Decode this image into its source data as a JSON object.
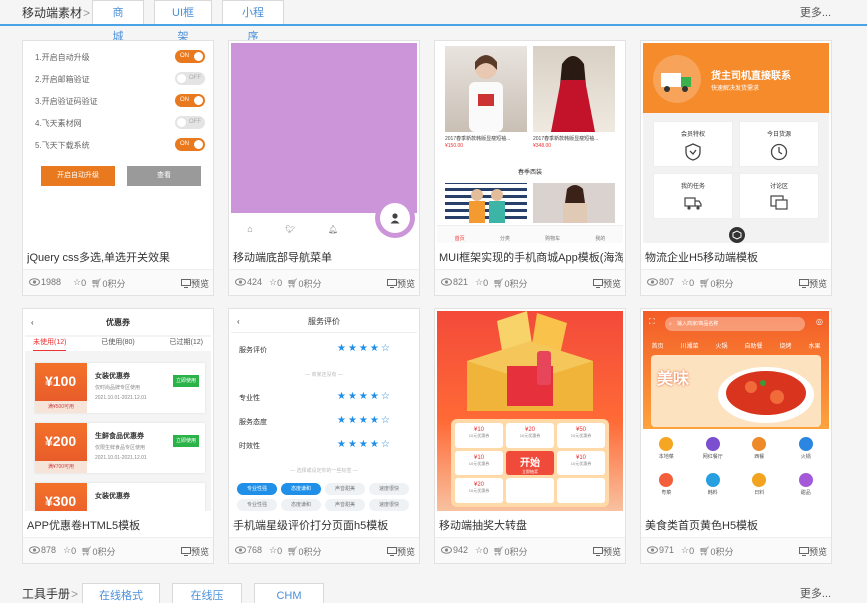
{
  "section_top": {
    "title": "移动端素材",
    "arrow": ">",
    "tabs": [
      "商城",
      "UI框架",
      "小程序"
    ],
    "more": "更多..."
  },
  "section_bottom": {
    "title": "工具手册",
    "arrow": ">",
    "tabs": [
      "在线格式化",
      "在线压缩",
      "CHM文档"
    ],
    "more": "更多..."
  },
  "preview_label": "预览",
  "cards": [
    {
      "title": "jQuery css多选,单选开关效果",
      "views": "1988",
      "stars": "0",
      "points": "0积分"
    },
    {
      "title": "移动端底部导航菜单",
      "views": "424",
      "stars": "0",
      "points": "0积分"
    },
    {
      "title": "MUI框架实现的手机商城App模板(海淘)",
      "views": "821",
      "stars": "0",
      "points": "0积分"
    },
    {
      "title": "物流企业H5移动端模板",
      "views": "807",
      "stars": "0",
      "points": "0积分"
    },
    {
      "title": "APP优惠卷HTML5模板",
      "views": "878",
      "stars": "0",
      "points": "0积分"
    },
    {
      "title": "手机端星级评价打分页面h5模板",
      "views": "768",
      "stars": "0",
      "points": "0积分"
    },
    {
      "title": "移动端抽奖大转盘",
      "views": "942",
      "stars": "0",
      "points": "0积分"
    },
    {
      "title": "美食类首页黄色H5模板",
      "views": "971",
      "stars": "0",
      "points": "0积分"
    }
  ],
  "toggles": {
    "rows": [
      {
        "label": "1.开启自动升级",
        "state": "ON"
      },
      {
        "label": "2.开启邮箱验证",
        "state": "OFF"
      },
      {
        "label": "3.开启验证码验证",
        "state": "ON"
      },
      {
        "label": "4.飞天素材网",
        "state": "OFF"
      },
      {
        "label": "5.飞天下载系统",
        "state": "ON"
      }
    ],
    "btn_primary": "开启自动升级",
    "btn_secondary": "查看"
  },
  "shop": {
    "p1_text": "2017春季新款韩版显瘦短袖...",
    "p1_price": "¥150.00",
    "p2_text": "2017春季新款韩版显瘦短袖...",
    "p2_price": "¥348.00",
    "spring": "春季西装",
    "nav": [
      "首页",
      "分类",
      "购物车",
      "我的"
    ]
  },
  "logistics": {
    "title": "货主司机直接联系",
    "subtitle": "快速解决发货需求",
    "cells": [
      "会员特权",
      "今日货源",
      "我的任务",
      "讨论区"
    ]
  },
  "coupon": {
    "header": "优惠券",
    "tabs": [
      "未使用(12)",
      "已使用(80)",
      "已过期(12)"
    ],
    "items": [
      {
        "amount": "¥100",
        "min": "满¥500可用",
        "name": "女装优惠券",
        "desc": "仅时尚品牌专区使用",
        "date": "2021.10.01-2021.12.01",
        "btn": "立即使用"
      },
      {
        "amount": "¥200",
        "min": "满¥700可用",
        "name": "生鲜食品优惠券",
        "desc": "仅限生鲜食品专区使用",
        "date": "2021.10.01-2021.12.01",
        "btn": "立即使用"
      },
      {
        "amount": "¥300",
        "min": "",
        "name": "女装优惠券",
        "desc": "",
        "date": "",
        "btn": ""
      }
    ]
  },
  "review": {
    "header": "服务评价",
    "row1": "服务评价",
    "sep1": "— 商家还没有 —",
    "rows": [
      "专业性",
      "服务态度",
      "时效性"
    ],
    "sep2": "— 选择或设定你的一些标签 —",
    "chips": [
      "专业性强",
      "态度谦和",
      "声音甜美",
      "速度很快",
      "专业性强",
      "态度谦和",
      "声音甜美",
      "速度很快"
    ],
    "star_glyphs": "★★★★☆"
  },
  "lottery": {
    "start": "开始",
    "center_sub": "立即抽奖",
    "prizes": [
      "¥10",
      "¥20",
      "¥50",
      "¥10",
      "¥10",
      "¥20"
    ],
    "prize_label": "10元优惠券"
  },
  "food": {
    "search": "输入商家/商品名称",
    "cats": [
      "首页",
      "川湘菜",
      "火锅",
      "自助餐",
      "烧烤",
      "水果"
    ],
    "banner": "美味",
    "icons_row1": [
      "本地菜",
      "网红餐厅",
      "西餐",
      "火锅"
    ],
    "icons_row2": [
      "粤菜",
      "韩料",
      "日料",
      "甜品"
    ]
  },
  "colors": {
    "accent_blue": "#4aa3e6",
    "link_blue": "#4a90d9",
    "toggle_orange": "#e8791f",
    "star_blue": "#1f8fe8",
    "purple": "#cc95d9"
  }
}
